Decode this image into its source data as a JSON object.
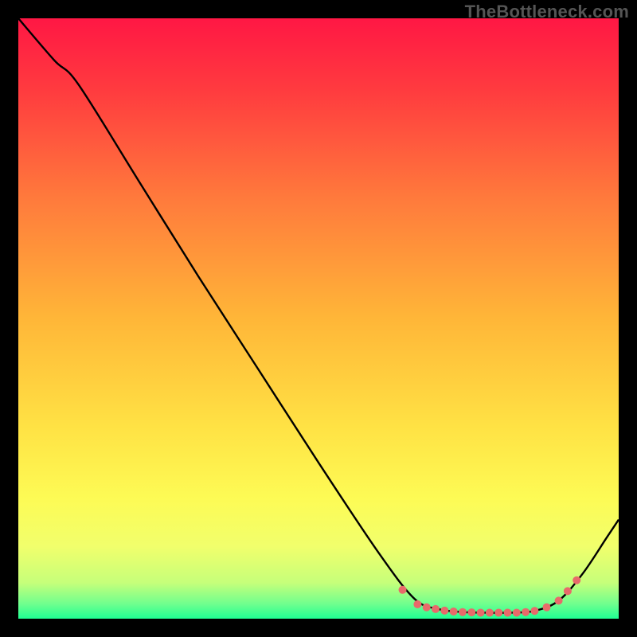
{
  "watermark": "TheBottleneck.com",
  "chart_data": {
    "type": "line",
    "title": "",
    "xlabel": "",
    "ylabel": "",
    "xlim": [
      0,
      100
    ],
    "ylim": [
      0,
      100
    ],
    "grid": false,
    "legend": false,
    "background_gradient": {
      "stops": [
        {
          "offset": 0.0,
          "color": "#ff1744"
        },
        {
          "offset": 0.12,
          "color": "#ff3b3f"
        },
        {
          "offset": 0.3,
          "color": "#ff7a3c"
        },
        {
          "offset": 0.5,
          "color": "#ffb638"
        },
        {
          "offset": 0.68,
          "color": "#ffe244"
        },
        {
          "offset": 0.8,
          "color": "#fdfb55"
        },
        {
          "offset": 0.88,
          "color": "#f1ff6c"
        },
        {
          "offset": 0.94,
          "color": "#c6ff7a"
        },
        {
          "offset": 0.975,
          "color": "#71ff8e"
        },
        {
          "offset": 1.0,
          "color": "#1fff93"
        }
      ]
    },
    "series": [
      {
        "name": "bottleneck-curve",
        "stroke": "#000000",
        "stroke_width": 2.4,
        "x": [
          0,
          6,
          10,
          20,
          30,
          40,
          50,
          60,
          66,
          70,
          74,
          78,
          82,
          86,
          90,
          94,
          98,
          100
        ],
        "y": [
          100,
          93,
          89,
          73,
          57,
          41.5,
          26,
          11,
          3.3,
          1.6,
          1.1,
          1.0,
          1.0,
          1.3,
          3.0,
          7.5,
          13.5,
          16.5
        ]
      }
    ],
    "markers": {
      "name": "optimum-points",
      "color": "#e86a6a",
      "radius": 5,
      "x": [
        64,
        66.5,
        68,
        69.5,
        71,
        72.5,
        74,
        75.5,
        77,
        78.5,
        80,
        81.5,
        83,
        84.5,
        86,
        88,
        90,
        91.5,
        93
      ],
      "y": [
        4.8,
        2.4,
        1.9,
        1.6,
        1.35,
        1.2,
        1.1,
        1.05,
        1.0,
        1.0,
        1.0,
        1.0,
        1.0,
        1.1,
        1.3,
        1.9,
        3.0,
        4.6,
        6.4
      ]
    }
  }
}
